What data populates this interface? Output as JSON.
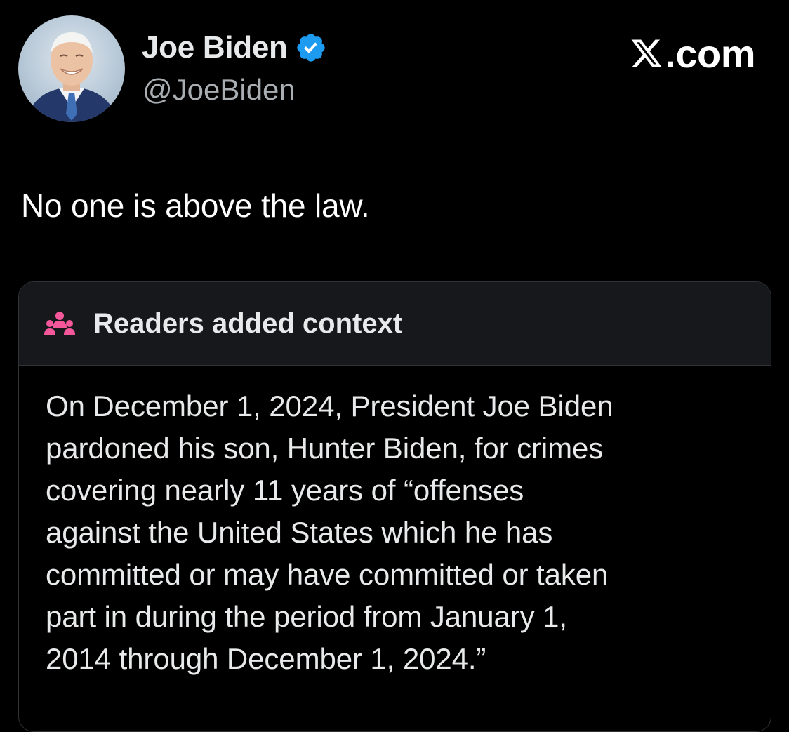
{
  "author": {
    "display_name": "Joe Biden",
    "handle": "@JoeBiden",
    "verified": true
  },
  "brand": {
    "text": ".com",
    "logo": "x-logo-icon"
  },
  "tweet": {
    "text": "No one is above the law."
  },
  "community_note": {
    "title": "Readers added context",
    "icon": "people-icon",
    "body": "On December 1, 2024, President Joe Biden\npardoned his son, Hunter Biden, for crimes\ncovering nearly 11 years of “offenses\nagainst the United States which he has\ncommitted or may have committed or taken\npart in during the period from January 1,\n2014 through December 1, 2024.”"
  },
  "colors": {
    "background": "#000000",
    "text": "#e7e9ea",
    "muted": "#a9aeb3",
    "verified_blue": "#1d9bf0",
    "note_header_bg": "#16181c",
    "note_icon_pink": "#f4579a"
  }
}
